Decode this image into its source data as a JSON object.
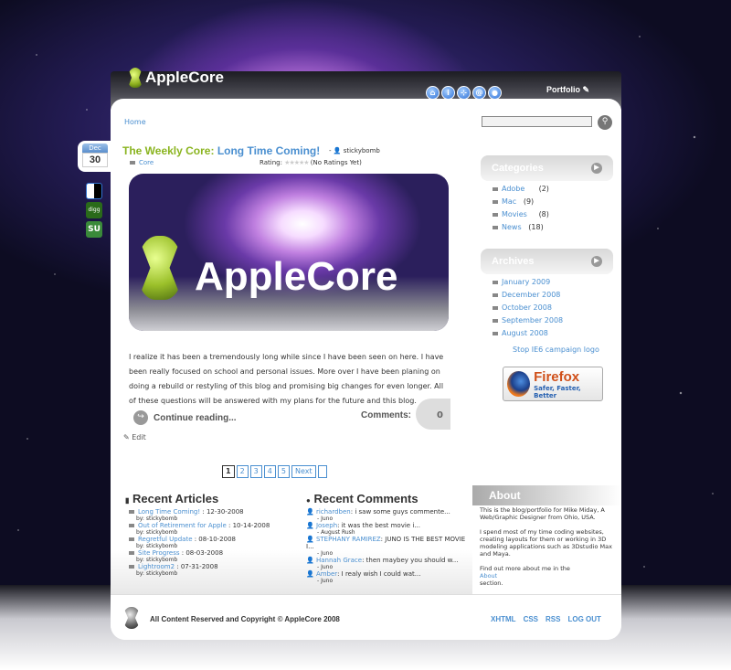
{
  "header": {
    "logo_text": "AppleCore",
    "nav_icons": [
      {
        "name": "home-icon",
        "glyph": "⌂"
      },
      {
        "name": "info-icon",
        "glyph": "i"
      },
      {
        "name": "network-icon",
        "glyph": "⊹"
      },
      {
        "name": "at-icon",
        "glyph": "@"
      },
      {
        "name": "user-icon",
        "glyph": "●"
      }
    ],
    "portfolio_label": "Portfolio"
  },
  "breadcrumb": {
    "home": "Home"
  },
  "search": {
    "button_glyph": "⚲"
  },
  "post": {
    "date_month": "Dec",
    "date_day": "30",
    "title_part1": "The Weekly Core:",
    "title_part2": " Long Time Coming!",
    "author_prefix": "-",
    "author": "stickybomb",
    "category": "Core",
    "rating_label": "Rating:",
    "rating_text": "(No Ratings Yet)",
    "banner_text": "AppleCore",
    "body": "I realize it has been a tremendously long while since I have been seen on here. I have been really focused on school and personal issues. More over I have been planing on doing a rebuild or restyling of this blog and promising big changes for even longer. All of these questions will be answered with my plans for the future and this blog.",
    "continue_label": "Continue reading...",
    "comments_label": "Comments:",
    "comments_count": "0",
    "edit_label": "Edit"
  },
  "social": [
    {
      "name": "delicious-icon",
      "colors": [
        "#fff",
        "#000",
        "#3274d0"
      ]
    },
    {
      "name": "digg-icon",
      "colors": [
        "#2a6a1a"
      ]
    },
    {
      "name": "stumbleupon-icon",
      "colors": [
        "#3a8a3a"
      ]
    }
  ],
  "pagination": [
    "1",
    "2",
    "3",
    "4",
    "5",
    "Next"
  ],
  "sidebar": {
    "categories_title": "Categories",
    "categories": [
      {
        "label": "Adobe",
        "count": "(2)"
      },
      {
        "label": "Mac",
        "count": "(9)"
      },
      {
        "label": "Movies",
        "count": "(8)"
      },
      {
        "label": "News",
        "count": "(18)"
      }
    ],
    "archives_title": "Archives",
    "archives": [
      "January 2009",
      "December 2008",
      "October 2008",
      "September 2008",
      "August 2008"
    ],
    "stop_ie6": "Stop IE6 campaign logo",
    "firefox_title": "Firefox",
    "firefox_sub": "Safer, Faster, Better"
  },
  "recent_articles": {
    "title": "Recent Articles",
    "items": [
      {
        "title": "Long Time Coming!",
        "date": " : 12-30-2008",
        "by": "by: stickybomb"
      },
      {
        "title": "Out of Retirement for Apple",
        "date": " : 10-14-2008",
        "by": "by: stickybomb"
      },
      {
        "title": "Regretful Update",
        "date": " : 08-10-2008",
        "by": "by: stickybomb"
      },
      {
        "title": "Site Progress",
        "date": " : 08-03-2008",
        "by": "by: stickybomb"
      },
      {
        "title": "Lightroom2",
        "date": " : 07-31-2008",
        "by": "by: stickybomb"
      }
    ]
  },
  "recent_comments": {
    "title": "Recent Comments",
    "items": [
      {
        "author": "richardben",
        "text": ": i saw some guys commente...",
        "by": "- Juno"
      },
      {
        "author": "Joseph",
        "text": ": it was the best movie i...",
        "by": "- August Rush"
      },
      {
        "author": "STEPHANY RAMIREZ",
        "text": ": JUNO IS THE BEST MOVIE I...",
        "by": "- Juno"
      },
      {
        "author": "Hannah Grace",
        "text": ": then maybey you should w...",
        "by": "- Juno"
      },
      {
        "author": "Amber",
        "text": ": I realy wish I could wat...",
        "by": "- Juno"
      }
    ]
  },
  "about": {
    "title": "About",
    "p1": "This is the blog/portfolio for Mike Miday, A Web/Graphic Designer from Ohio, USA.",
    "p2": "I spend most of my time coding websites, creating layouts for them or working in 3D modeling applications such as 3Dstudio Max and Maya.",
    "p3_prefix": "Find out more about me in the",
    "p3_link": "About",
    "p3_suffix": "section."
  },
  "footer": {
    "copyright": "All Content Reserved and Copyright © AppleCore 2008",
    "links": [
      "XHTML",
      "CSS",
      "RSS",
      "LOG OUT"
    ]
  }
}
